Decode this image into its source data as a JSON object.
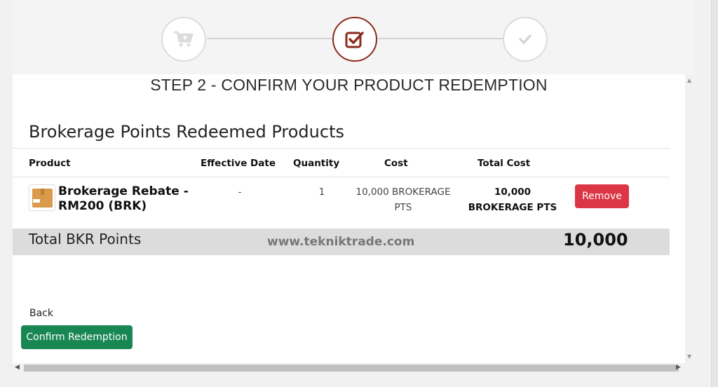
{
  "stepper": {
    "steps": [
      {
        "icon": "cart-plus-icon",
        "state": "done"
      },
      {
        "icon": "checkbox-checked-icon",
        "state": "active"
      },
      {
        "icon": "checkmark-icon",
        "state": "pending"
      }
    ],
    "active_color": "#8b2a1b"
  },
  "page": {
    "step_title": "STEP 2 - CONFIRM YOUR PRODUCT REDEMPTION",
    "section_title": "Brokerage Points Redeemed Products"
  },
  "table": {
    "headers": {
      "product": "Product",
      "effective_date": "Effective Date",
      "quantity": "Quantity",
      "cost": "Cost",
      "total_cost": "Total Cost"
    },
    "row": {
      "product_name": "Brokerage Rebate - RM200 (BRK)",
      "effective_date": "-",
      "quantity": "1",
      "cost_line1": "10,000 BROKERAGE",
      "cost_line2": "PTS",
      "total_line1": "10,000",
      "total_line2": "BROKERAGE PTS",
      "remove_label": "Remove"
    }
  },
  "totals": {
    "label": "Total BKR Points",
    "watermark": "www.tekniktrade.com",
    "value": "10,000"
  },
  "actions": {
    "back_label": "Back",
    "confirm_label": "Confirm Redemption"
  },
  "colors": {
    "remove": "#dc3545",
    "confirm": "#198754",
    "total_bar": "#dcdcdc"
  }
}
